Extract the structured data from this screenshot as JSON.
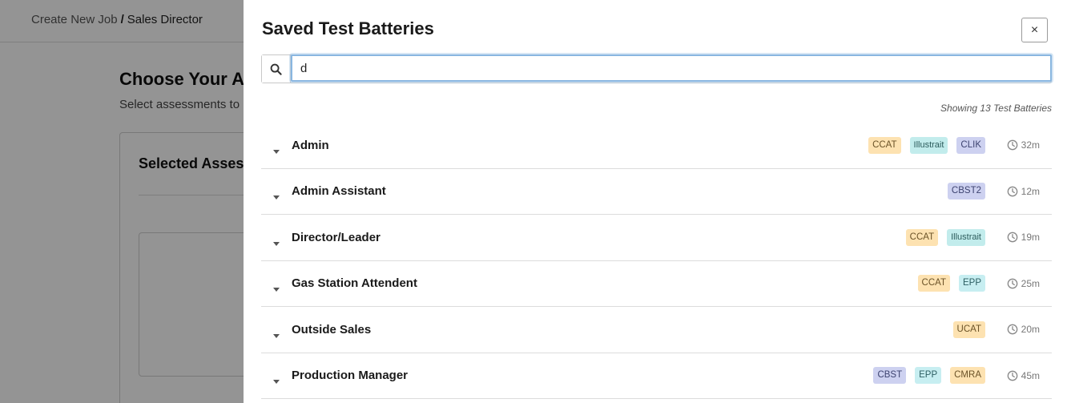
{
  "background": {
    "breadcrumb": {
      "root": "Create New Job",
      "separator": "/",
      "current": "Sales Director"
    },
    "heading": "Choose Your As",
    "subtext": "Select assessments to",
    "card_title": "Selected Assess"
  },
  "drawer": {
    "title": "Saved Test Batteries",
    "close_label": "×",
    "search": {
      "value": "d",
      "placeholder": ""
    },
    "count_text": "Showing 13 Test Batteries",
    "rows": [
      {
        "name": "Admin",
        "tags": [
          "CCAT",
          "Illustrait",
          "CLIK"
        ],
        "duration": "32m"
      },
      {
        "name": "Admin Assistant",
        "tags": [
          "CBST2"
        ],
        "duration": "12m"
      },
      {
        "name": "Director/Leader",
        "tags": [
          "CCAT",
          "Illustrait"
        ],
        "duration": "19m"
      },
      {
        "name": "Gas Station Attendent",
        "tags": [
          "CCAT",
          "EPP"
        ],
        "duration": "25m"
      },
      {
        "name": "Outside Sales",
        "tags": [
          "UCAT"
        ],
        "duration": "20m"
      },
      {
        "name": "Production Manager",
        "tags": [
          "CBST",
          "EPP",
          "CMRA"
        ],
        "duration": "45m"
      }
    ]
  },
  "icons": {
    "search": "search-icon",
    "caret": "caret-down-icon",
    "clock": "clock-icon",
    "close": "close-icon"
  },
  "colors": {
    "overlay": "#6b6b6b",
    "focus_ring": "#89b6e0",
    "tag_orange": "#fde2b1",
    "tag_teal": "#c2ecec",
    "tag_purple": "#cdd1f0"
  }
}
